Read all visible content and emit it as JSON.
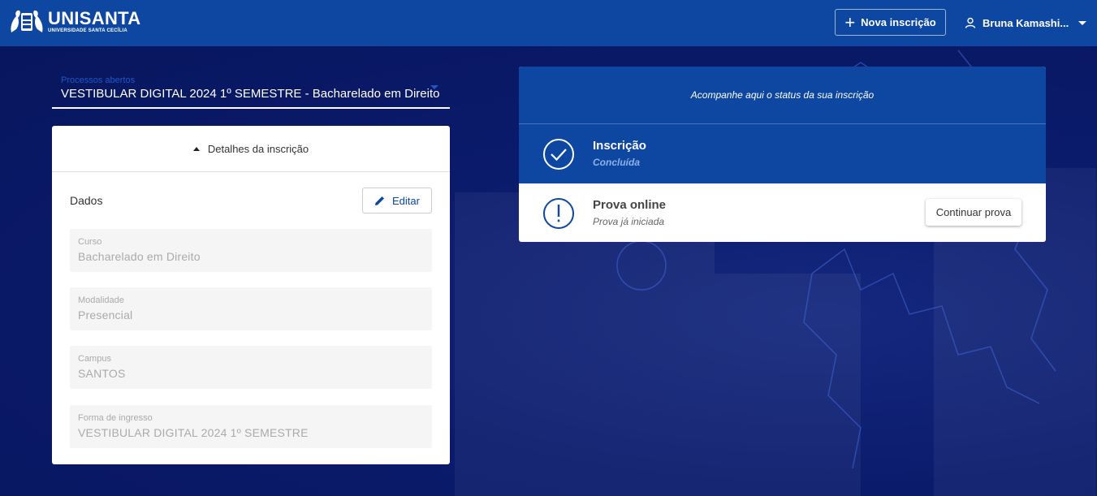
{
  "header": {
    "logo_main": "UNISANTA",
    "logo_sub": "UNIVERSIDADE SANTA CECÍLIA",
    "new_button": "Nova inscrição",
    "user_name": "Bruna Kamashi..."
  },
  "process_select": {
    "label": "Processos abertos",
    "value": "VESTIBULAR DIGITAL 2024 1º SEMESTRE - Bacharelado em Direito"
  },
  "details": {
    "toggle_label": "Detalhes da inscrição",
    "section_title": "Dados",
    "edit_button": "Editar",
    "fields": [
      {
        "label": "Curso",
        "value": "Bacharelado em Direito"
      },
      {
        "label": "Modalidade",
        "value": "Presencial"
      },
      {
        "label": "Campus",
        "value": "SANTOS"
      },
      {
        "label": "Forma de ingresso",
        "value": "VESTIBULAR DIGITAL 2024 1º SEMESTRE"
      }
    ]
  },
  "status": {
    "heading": "Acompanhe aqui o status da sua inscrição",
    "steps": [
      {
        "title": "Inscrição",
        "subtitle": "Concluída",
        "icon": "check-circle-icon"
      },
      {
        "title": "Prova online",
        "subtitle": "Prova já iniciada",
        "icon": "exclamation-circle-icon",
        "action": "Continuar prova"
      }
    ]
  },
  "colors": {
    "primary": "#0d47a1",
    "background": "#0a1a6b",
    "accent_text": "#1f57c3"
  }
}
